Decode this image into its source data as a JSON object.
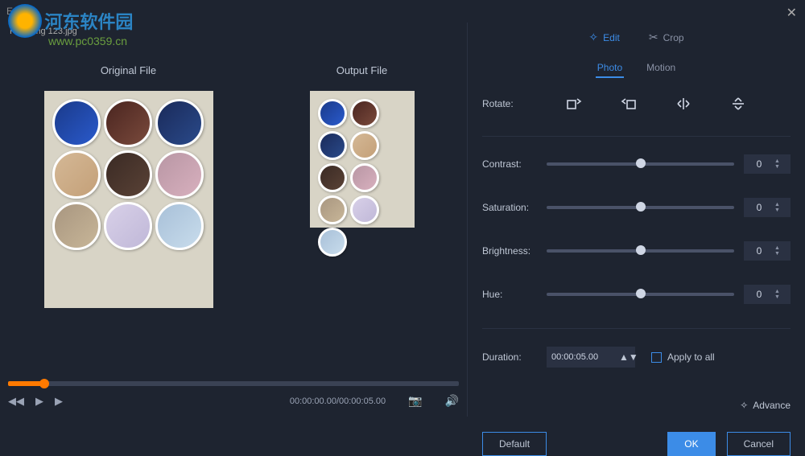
{
  "window": {
    "title": "Edit"
  },
  "watermark": {
    "name": "河东软件园",
    "url": "www.pc0359.cn"
  },
  "file": {
    "label": "File: tlmg 123.jpg"
  },
  "preview": {
    "original": "Original File",
    "output": "Output File"
  },
  "player": {
    "time": "00:00:00.00/00:00:05.00"
  },
  "modes": {
    "edit": "Edit",
    "crop": "Crop"
  },
  "subtabs": {
    "photo": "Photo",
    "motion": "Motion"
  },
  "labels": {
    "rotate": "Rotate:",
    "contrast": "Contrast:",
    "saturation": "Saturation:",
    "brightness": "Brightness:",
    "hue": "Hue:",
    "duration": "Duration:",
    "apply_all": "Apply to all"
  },
  "values": {
    "contrast": "0",
    "saturation": "0",
    "brightness": "0",
    "hue": "0",
    "duration": "00:00:05.00"
  },
  "buttons": {
    "advance": "Advance",
    "default": "Default",
    "ok": "OK",
    "cancel": "Cancel"
  }
}
